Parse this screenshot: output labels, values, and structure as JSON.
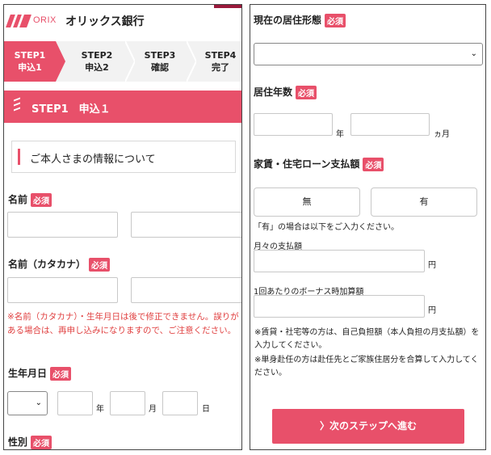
{
  "header": {
    "logo_en": "ORIX",
    "logo_ja": "オリックス銀行"
  },
  "steps": [
    {
      "num": "STEP1",
      "name": "申込1",
      "active": true
    },
    {
      "num": "STEP2",
      "name": "申込2",
      "active": false
    },
    {
      "num": "STEP3",
      "name": "確認",
      "active": false
    },
    {
      "num": "STEP4",
      "name": "完了",
      "active": false
    }
  ],
  "step_title": "STEP1　申込１",
  "section_title": "ご本人さまの情報について",
  "required_badge": "必須",
  "left_form": {
    "name_label": "名前",
    "kana_label": "名前（カタカナ）",
    "warning": "※名前（カタカナ）・生年月日は後で修正できません。誤りがある場合は、再申し込みになりますので、ご注意ください。",
    "birth_label": "生年月日",
    "year_unit": "年",
    "month_unit": "月",
    "day_unit": "日",
    "gender_label": "性別"
  },
  "right_form": {
    "residence_label": "現在の居住形態",
    "years_label": "居住年数",
    "years_unit": "年",
    "months_unit": "ヵ月",
    "rent_label": "家賃・住宅ローン支払額",
    "option_none": "無",
    "option_yes": "有",
    "rent_hint": "「有」の場合は以下をご入力ください。",
    "monthly_label": "月々の支払額",
    "bonus_label": "1回あたりのボーナス時加算額",
    "yen_unit": "円",
    "note1": "※賃貸・社宅等の方は、自己負担額（本人負担の月支払額）を入力してください。",
    "note2": "※単身赴任の方は赴任先とご家族住居分を合算して入力してください。",
    "next_button": "〉次のステップへ進む"
  },
  "colors": {
    "accent": "#e8506a",
    "warning": "#e04040"
  }
}
